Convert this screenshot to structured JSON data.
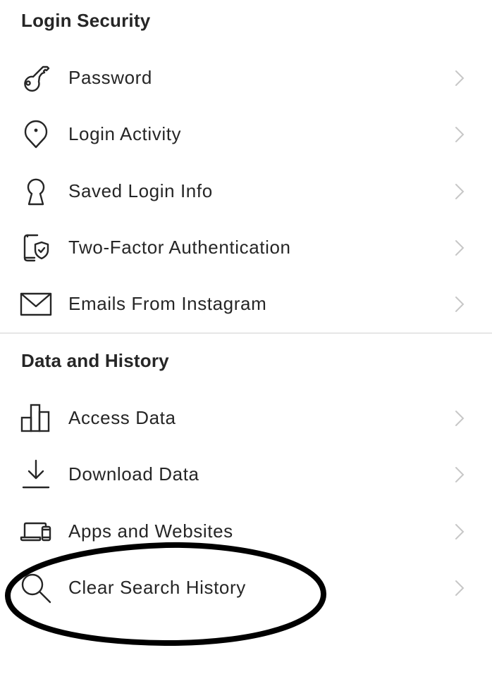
{
  "sections": [
    {
      "title": "Login Security",
      "items": [
        {
          "label": "Password",
          "icon": "key-icon"
        },
        {
          "label": "Login Activity",
          "icon": "location-pin-icon"
        },
        {
          "label": "Saved Login Info",
          "icon": "keyhole-icon"
        },
        {
          "label": "Two-Factor Authentication",
          "icon": "phone-shield-icon"
        },
        {
          "label": "Emails From Instagram",
          "icon": "envelope-icon"
        }
      ]
    },
    {
      "title": "Data and History",
      "items": [
        {
          "label": "Access Data",
          "icon": "bar-chart-icon"
        },
        {
          "label": "Download Data",
          "icon": "download-icon"
        },
        {
          "label": "Apps and Websites",
          "icon": "laptop-phone-icon"
        },
        {
          "label": "Clear Search History",
          "icon": "search-icon"
        }
      ]
    }
  ],
  "chevron_icon": "chevron-right-icon",
  "annotation": {
    "shape": "hand-drawn-ellipse",
    "highlights": "Clear Search History",
    "color": "#000000"
  },
  "colors": {
    "text": "#262626",
    "chevron": "#c7c7c7",
    "divider": "#e6e6e6",
    "background": "#ffffff"
  }
}
